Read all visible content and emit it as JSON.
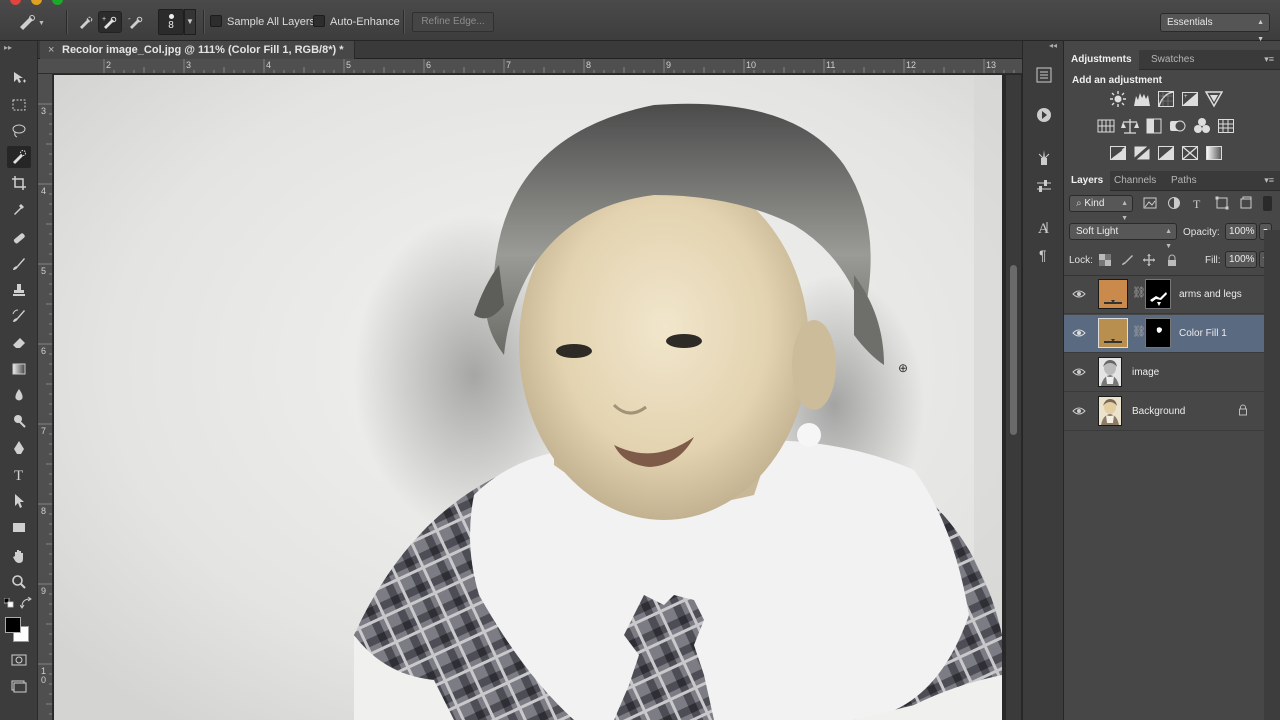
{
  "window": {
    "title": ""
  },
  "options_bar": {
    "brush_size": "8",
    "sample_all_layers_label": "Sample All Layers",
    "auto_enhance_label": "Auto-Enhance",
    "refine_edge_label": "Refine Edge...",
    "workspace_value": "Essentials"
  },
  "document": {
    "tab_title": "Recolor image_Col.jpg @ 111% (Color Fill 1, RGB/8*) *",
    "close_glyph": "×",
    "hruler_ticks": [
      "2",
      "3",
      "4",
      "5",
      "6",
      "7",
      "8",
      "9",
      "10",
      "11",
      "12",
      "13"
    ],
    "vruler_ticks": [
      "3",
      "4",
      "5",
      "6",
      "7",
      "8",
      "9",
      "1\n0"
    ]
  },
  "adjustments_panel": {
    "tabs": [
      "Adjustments",
      "Swatches"
    ],
    "heading": "Add an adjustment",
    "icon_rows": [
      [
        "brightness-contrast-icon",
        "levels-icon",
        "curves-icon",
        "exposure-icon",
        "vibrance-icon"
      ],
      [
        "hue-saturation-icon",
        "color-balance-icon",
        "black-white-icon",
        "photo-filter-icon",
        "channel-mixer-icon",
        "color-lookup-icon"
      ],
      [
        "invert-icon",
        "posterize-icon",
        "threshold-icon",
        "selective-color-icon",
        "gradient-map-icon"
      ]
    ]
  },
  "layers_panel": {
    "tabs": [
      "Layers",
      "Channels",
      "Paths"
    ],
    "filter_kind": "Kind",
    "blend_mode": "Soft Light",
    "opacity_label": "Opacity:",
    "opacity_value": "100%",
    "lock_label": "Lock:",
    "fill_label": "Fill:",
    "fill_value": "100%",
    "layers": [
      {
        "name": "arms and legs",
        "type": "fill",
        "color": "#c98a4c",
        "selected": false
      },
      {
        "name": "Color Fill 1",
        "type": "fill",
        "color": "#b88f4e",
        "selected": true
      },
      {
        "name": "image",
        "type": "image",
        "selected": false
      },
      {
        "name": "Background",
        "type": "image",
        "selected": false,
        "locked": true
      }
    ]
  },
  "colors": {
    "selection": "#5a6a80",
    "foreground": "#000000",
    "background": "#ffffff"
  }
}
